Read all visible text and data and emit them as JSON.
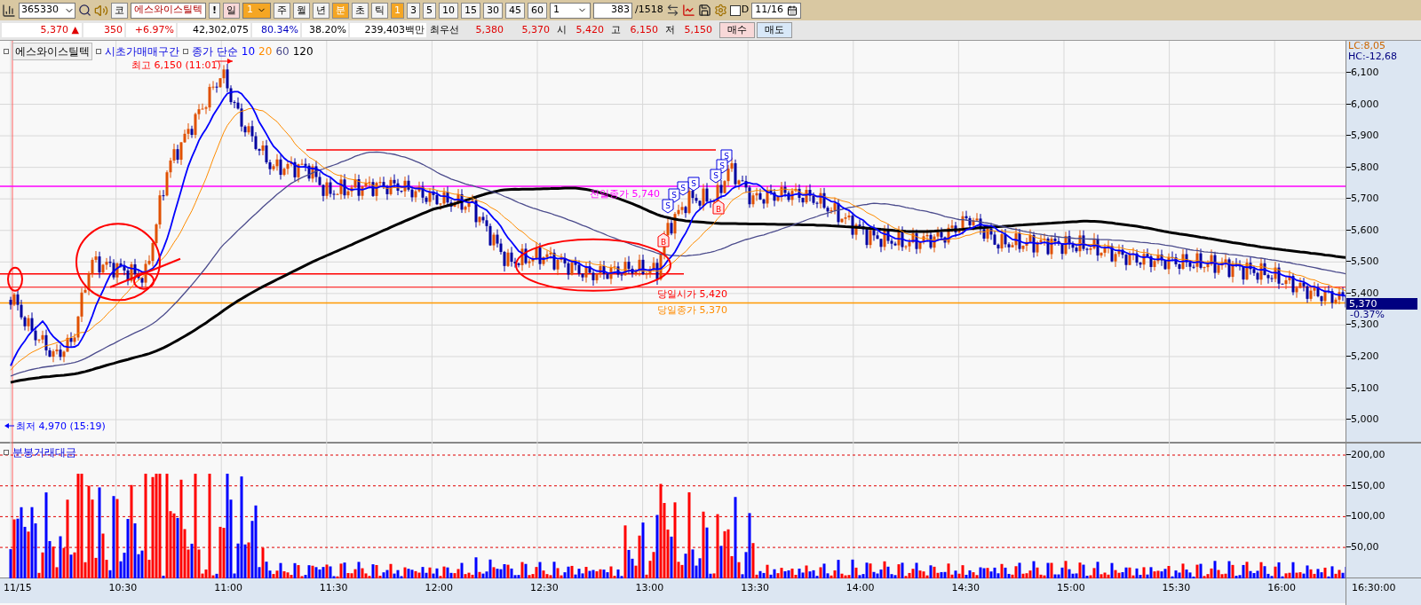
{
  "toolbar": {
    "code": "365330",
    "market_button": "코",
    "stock_name": "에스와이스틸텍",
    "alert_button": "!",
    "day_button": "일",
    "day_count": "1",
    "periods": [
      {
        "label": "주",
        "selected": false
      },
      {
        "label": "월",
        "selected": false
      },
      {
        "label": "년",
        "selected": false
      },
      {
        "label": "분",
        "selected": true
      },
      {
        "label": "초",
        "selected": false
      },
      {
        "label": "틱",
        "selected": false
      }
    ],
    "minute_options": [
      {
        "label": "1",
        "selected": true
      },
      {
        "label": "3",
        "selected": false
      },
      {
        "label": "5",
        "selected": false
      },
      {
        "label": "10",
        "selected": false
      },
      {
        "label": "15",
        "selected": false
      },
      {
        "label": "30",
        "selected": false
      },
      {
        "label": "45",
        "selected": false
      },
      {
        "label": "60",
        "selected": false
      }
    ],
    "interval": "1",
    "count": "383",
    "total": "/1518",
    "d_checkbox": {
      "label": "D",
      "checked": false
    },
    "date": "11/16"
  },
  "quote": {
    "price": "5,370 ▲",
    "change": "350",
    "rate": "+6.97%",
    "volume": "42,302,075",
    "ratio_1": "80.34%",
    "ratio_2": "38.20%",
    "amount": "239,403백만",
    "best_label": "최우선",
    "ask": "5,380",
    "bid": "5,370",
    "open_label": "시",
    "open": "5,420",
    "high_label": "고",
    "high": "6,150",
    "low_label": "저",
    "low": "5,150",
    "buttons": [
      {
        "label": "매수",
        "kind": "buy"
      },
      {
        "label": "매도",
        "kind": "sell"
      }
    ]
  },
  "price_pane": {
    "legend": {
      "stock": "에스와이스틸텍",
      "indicator": "시초가매매구간",
      "ma_label": "종가 단순",
      "periods": [
        {
          "label": "10",
          "color": "#0000ff"
        },
        {
          "label": "20",
          "color": "#ff8c00"
        },
        {
          "label": "60",
          "color": "#4b4b8c"
        },
        {
          "label": "120",
          "color": "#000000"
        }
      ]
    },
    "annotations": [
      {
        "kind": "high",
        "text": "최고 6,150 (11:01)"
      },
      {
        "kind": "low",
        "text": "최저 4,970 (15:19)"
      },
      {
        "kind": "prev_close",
        "text": "전일종가 5,740"
      },
      {
        "kind": "open",
        "text": "당일시가 5,420"
      },
      {
        "kind": "close",
        "text": "당일종가 5,370"
      }
    ],
    "signals": [
      {
        "kind": "sell",
        "label": "S"
      },
      {
        "kind": "sell",
        "label": "S"
      },
      {
        "kind": "sell",
        "label": "S"
      },
      {
        "kind": "sell",
        "label": "S"
      },
      {
        "kind": "sell",
        "label": "S"
      },
      {
        "kind": "sell",
        "label": "S"
      },
      {
        "kind": "sell",
        "label": "S"
      },
      {
        "kind": "buy",
        "label": "B"
      },
      {
        "kind": "buy",
        "label": "B"
      }
    ],
    "lc": "LC:8,05",
    "hc": "HC:-12,68",
    "y_ticks": [
      "6,100",
      "6,000",
      "5,900",
      "5,800",
      "5,700",
      "5,600",
      "5,500",
      "5,400",
      "5,300",
      "5,200",
      "5,100",
      "5,000"
    ],
    "current": "5,370",
    "current_rate": "-0.37%"
  },
  "volume_pane": {
    "title": "분봉거래대금",
    "y_ticks": [
      "200,00",
      "150,00",
      "100,00",
      "50,00"
    ]
  },
  "x_axis": {
    "ticks": [
      "11/15",
      "10:30",
      "11:00",
      "11:30",
      "12:00",
      "12:30",
      "13:00",
      "13:30",
      "14:00",
      "14:30",
      "15:00",
      "15:30",
      "16:00"
    ],
    "end": "16:30:00"
  }
}
